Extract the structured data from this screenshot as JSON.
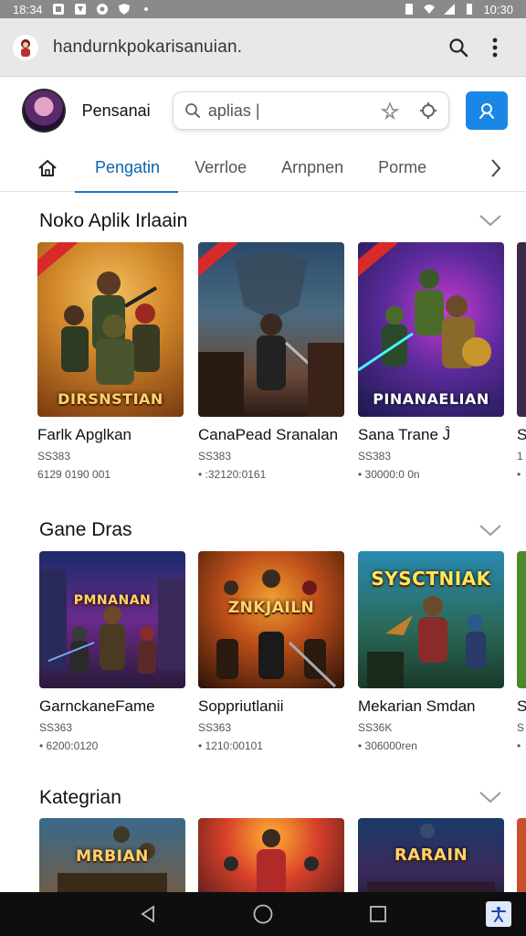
{
  "status_bar": {
    "time_left": "18:34",
    "time_right": "10:30"
  },
  "browser": {
    "url": "handurnkpokarisanuian.",
    "search_icon": "search-icon",
    "menu_icon": "more-vert-icon"
  },
  "header": {
    "user_name": "Pensanai",
    "search_value": "aplias |",
    "search_placeholder": "aplias"
  },
  "tabs": {
    "items": [
      "Pengatin",
      "Verrloe",
      "Arnpnen",
      "Porme"
    ],
    "active": "Pengatin"
  },
  "sections": [
    {
      "title": "Noko Aplik Irlaain",
      "cards": [
        {
          "art_label": "DIRSNSTIAN",
          "title": "Farlk Apglkan",
          "meta1": "SS383",
          "meta2": "6129 0190 001"
        },
        {
          "art_label": "",
          "title": "CanaPead Sranalan",
          "meta1": "SS383",
          "meta2": "• :32120:0161"
        },
        {
          "art_label": "PINANAELIAN",
          "title": "Sana Trane Ĵ",
          "meta1": "SS383",
          "meta2": "• 30000:0 0n"
        },
        {
          "art_label": "",
          "title": "S",
          "meta1": "1",
          "meta2": "•"
        }
      ]
    },
    {
      "title": "Gane Dras",
      "cards": [
        {
          "art_label": "PMNANAN",
          "title": "GarnckaneFame",
          "meta1": "SS363",
          "meta2": "• 6200:0120"
        },
        {
          "art_label": "ZNKJAILN",
          "title": "Soppriutlanii",
          "meta1": "SS363",
          "meta2": "• 1210:00101"
        },
        {
          "art_label": "SYSCTNIAK",
          "title": "Mekarian Smdan",
          "meta1": "SS36K",
          "meta2": "• 306000ren"
        },
        {
          "art_label": "",
          "title": "S",
          "meta1": "S",
          "meta2": "•"
        }
      ]
    },
    {
      "title": "Kategrian",
      "cards": [
        {
          "art_label": "MRBIAN",
          "title": "",
          "meta1": "",
          "meta2": ""
        },
        {
          "art_label": "",
          "title": "",
          "meta1": "",
          "meta2": ""
        },
        {
          "art_label": "RARAIN",
          "title": "",
          "meta1": "",
          "meta2": ""
        },
        {
          "art_label": "",
          "title": "",
          "meta1": "",
          "meta2": ""
        }
      ]
    }
  ],
  "colors": {
    "accent": "#1a87e6",
    "tab_active": "#0b63ad",
    "status_bar": "#8a8a8a",
    "nav_bar": "#0e0e0e"
  }
}
